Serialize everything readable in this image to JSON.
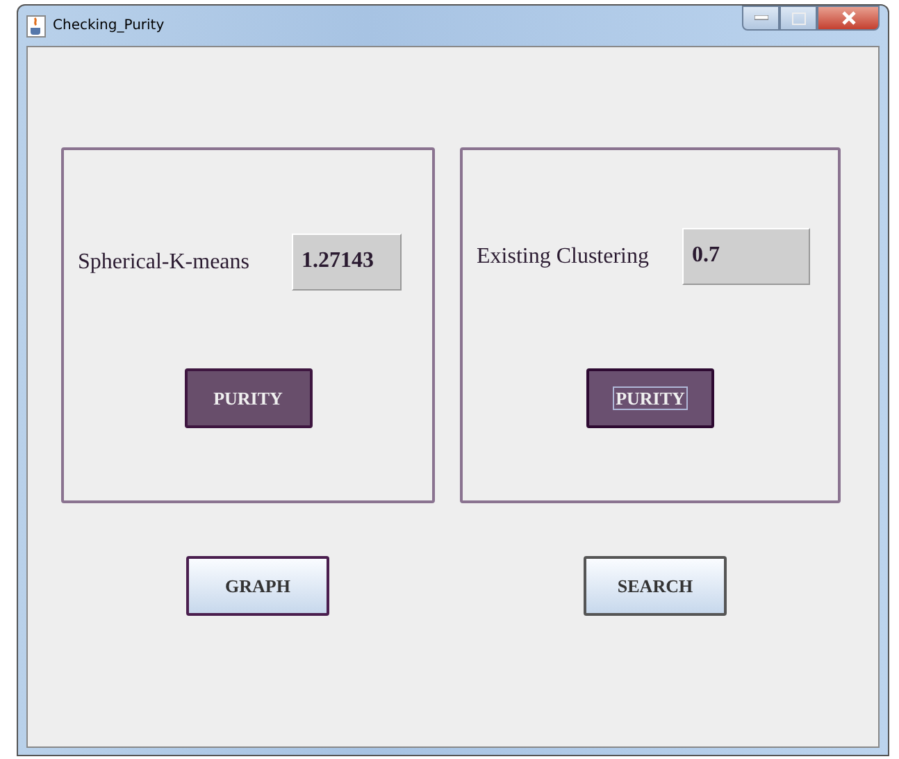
{
  "window": {
    "title": "Checking_Purity"
  },
  "panels": [
    {
      "label": "Spherical-K-means",
      "value": "1.27143",
      "button": {
        "label": "PURITY",
        "focused": false
      }
    },
    {
      "label": "Existing Clustering",
      "value": "0.7",
      "button": {
        "label": "PURITY",
        "focused": true
      }
    }
  ],
  "buttons": [
    {
      "label": "GRAPH",
      "kind": "primary"
    },
    {
      "label": "SEARCH",
      "kind": "plain"
    }
  ]
}
